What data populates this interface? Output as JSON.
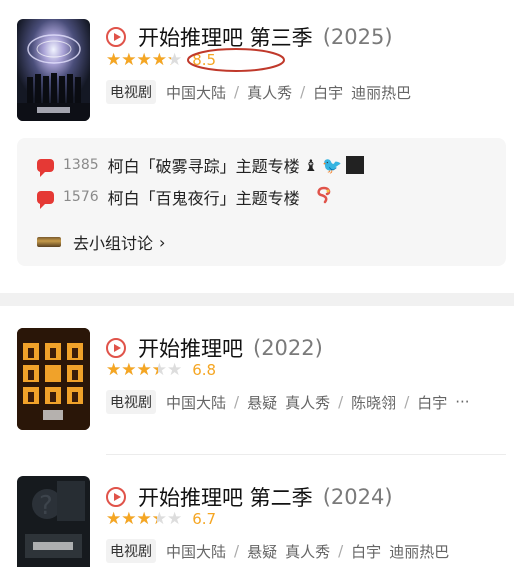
{
  "shows": [
    {
      "title": "开始推理吧 第三季",
      "year": "(2025)",
      "rating": "8.5",
      "rating_fraction": 0.85,
      "type_label": "电视剧",
      "tags": [
        "中国大陆",
        "真人秀",
        "白宇",
        "迪丽热巴"
      ]
    },
    {
      "title": "开始推理吧",
      "year": "(2022)",
      "rating": "6.8",
      "rating_fraction": 0.68,
      "type_label": "电视剧",
      "tags": [
        "中国大陆",
        "悬疑",
        "真人秀",
        "陈晓翎",
        "白宇"
      ],
      "more": "···"
    },
    {
      "title": "开始推理吧 第二季",
      "year": "(2024)",
      "rating": "6.7",
      "rating_fraction": 0.67,
      "type_label": "电视剧",
      "tags": [
        "中国大陆",
        "悬疑",
        "真人秀",
        "白宇",
        "迪丽热巴"
      ]
    }
  ],
  "group": {
    "posts": [
      {
        "count": "1385",
        "title": "柯白「破雾寻踪」主题专楼"
      },
      {
        "count": "1576",
        "title": "柯白「百鬼夜行」主题专楼"
      }
    ],
    "discuss_link": "去小组讨论",
    "chevron": "›"
  },
  "colors": {
    "accent": "#e0534a",
    "star": "#f5a623",
    "highlight_oval": "#c0392b"
  }
}
